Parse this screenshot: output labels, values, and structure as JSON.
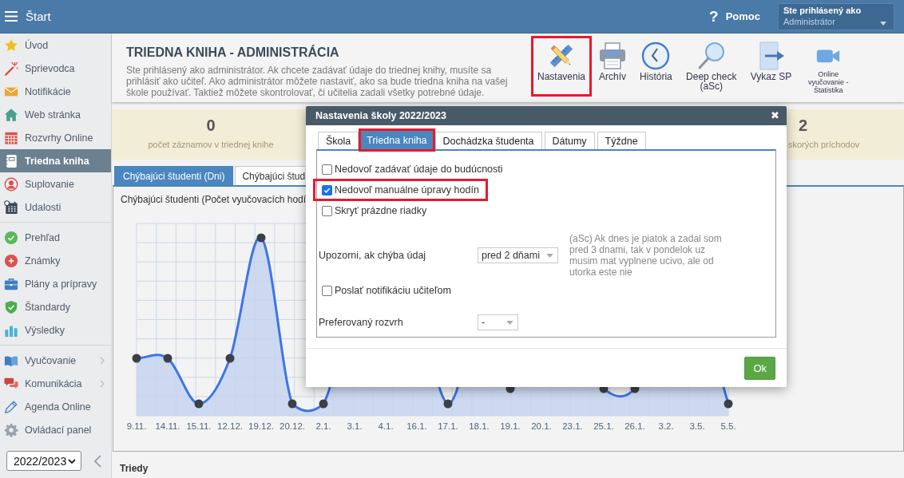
{
  "top_bar": {
    "title": "Štart",
    "help": {
      "icon": "?",
      "label": "Pomoc"
    },
    "user": {
      "caption": "Ste prihlásený ako",
      "name": "Administrátor"
    }
  },
  "sidebar": {
    "groups": [
      {
        "items": [
          {
            "label": "Úvod",
            "selected": false,
            "submenu": false
          },
          {
            "label": "Sprievodca",
            "selected": false,
            "submenu": false
          },
          {
            "label": "Notifikácie",
            "selected": false,
            "submenu": false
          },
          {
            "label": "Web stránka",
            "selected": false,
            "submenu": false
          },
          {
            "label": "Rozvrhy Online",
            "selected": false,
            "submenu": false
          },
          {
            "label": "Triedna kniha",
            "selected": true,
            "submenu": false
          },
          {
            "label": "Suplovanie",
            "selected": false,
            "submenu": false
          },
          {
            "label": "Udalosti",
            "selected": false,
            "submenu": false
          }
        ]
      },
      {
        "items": [
          {
            "label": "Prehľad",
            "selected": false,
            "submenu": false
          },
          {
            "label": "Známky",
            "selected": false,
            "submenu": false
          },
          {
            "label": "Plány a prípravy",
            "selected": false,
            "submenu": false
          },
          {
            "label": "Štandardy",
            "selected": false,
            "submenu": false
          },
          {
            "label": "Výsledky",
            "selected": false,
            "submenu": false
          }
        ]
      },
      {
        "items": [
          {
            "label": "Vyučovanie",
            "selected": false,
            "submenu": true
          },
          {
            "label": "Komunikácia",
            "selected": false,
            "submenu": true
          },
          {
            "label": "Agenda Online",
            "selected": false,
            "submenu": false
          },
          {
            "label": "Ovládací panel",
            "selected": false,
            "submenu": false
          }
        ]
      }
    ],
    "year": "2022/2023"
  },
  "header": {
    "title": "TRIEDNA KNIHA - ADMINISTRÁCIA",
    "description": "Ste prihlásený ako administrátor. Ak chcete zadávať údaje do triednej knihy, musíte sa prihlásiť ako učiteľ. Ako administrátor môžete nastaviť, ako sa bude triedna kniha na vašej škole používať. Taktiež môžete skontrolovať, či učitelia zadali všetky potrebné údaje.",
    "toolbar": [
      {
        "label": "Nastavenia",
        "highlighted": true
      },
      {
        "label": "Archív",
        "highlighted": false
      },
      {
        "label": "História",
        "highlighted": false
      },
      {
        "label": "Deep check (aSc)",
        "highlighted": false
      },
      {
        "label": "Vykaz SP",
        "highlighted": false
      },
      {
        "label": "Online vyučovanie - Štatistika",
        "highlighted": false
      }
    ]
  },
  "stats": [
    {
      "value": "0",
      "label": "počet záznamov v triednej knihe"
    },
    {
      "value": "2",
      "label": "skorých príchodov"
    }
  ],
  "chart_tabs": [
    {
      "label": "Chýbajúci študenti (Dni)",
      "selected": true
    },
    {
      "label": "Chýbajúci štud",
      "selected": false
    }
  ],
  "chart_panel": {
    "title": "Chýbajúci študenti (Počet vyučovacích hodí",
    "x_labels": [
      "9.11.",
      "14.11.",
      "15.11.",
      "12.12.",
      "19.12.",
      "20.12.",
      "2.1.",
      "3.1.",
      "4.1.",
      "16.1.",
      "17.1.",
      "18.1.",
      "19.1.",
      "20.1.",
      "23.1.",
      "25.1.",
      "26.1.",
      "3.2.",
      "3.5.",
      "5.5."
    ]
  },
  "section": {
    "title": "Triedy"
  },
  "dialog": {
    "title": "Nastavenia školy 2022/2023",
    "close": "✖",
    "tabs": [
      {
        "label": "Škola",
        "selected": false,
        "highlighted": false
      },
      {
        "label": "Triedna kniha",
        "selected": true,
        "highlighted": true
      },
      {
        "label": "Dochádzka študenta",
        "selected": false,
        "highlighted": false
      },
      {
        "label": "Dátumy",
        "selected": false,
        "highlighted": false
      },
      {
        "label": "Týždne",
        "selected": false,
        "highlighted": false
      }
    ],
    "options": [
      {
        "kind": "checkbox",
        "label": "Nedovoľ zadávať údaje do budúcnosti",
        "checked": false,
        "highlighted": false
      },
      {
        "kind": "checkbox",
        "label": "Nedovoľ manuálne úpravy hodín",
        "checked": true,
        "highlighted": true
      },
      {
        "kind": "checkbox",
        "label": "Skryť prázdne riadky",
        "checked": false,
        "highlighted": false
      },
      {
        "kind": "select",
        "label": "Upozorni, ak chýba údaj",
        "value": "pred 2 dňami",
        "note": "(aSc) Ak dnes je piatok a zadal som pred 3 dnami, tak v pondelok uz musim mat vyplnene ucivo, ale od utorka este nie"
      },
      {
        "kind": "checkbox",
        "label": "Poslať notifikáciu učiteľom",
        "checked": false,
        "highlighted": false
      },
      {
        "kind": "select",
        "label": "Preferovaný rozvrh",
        "value": "-"
      }
    ],
    "ok": "Ok"
  }
}
